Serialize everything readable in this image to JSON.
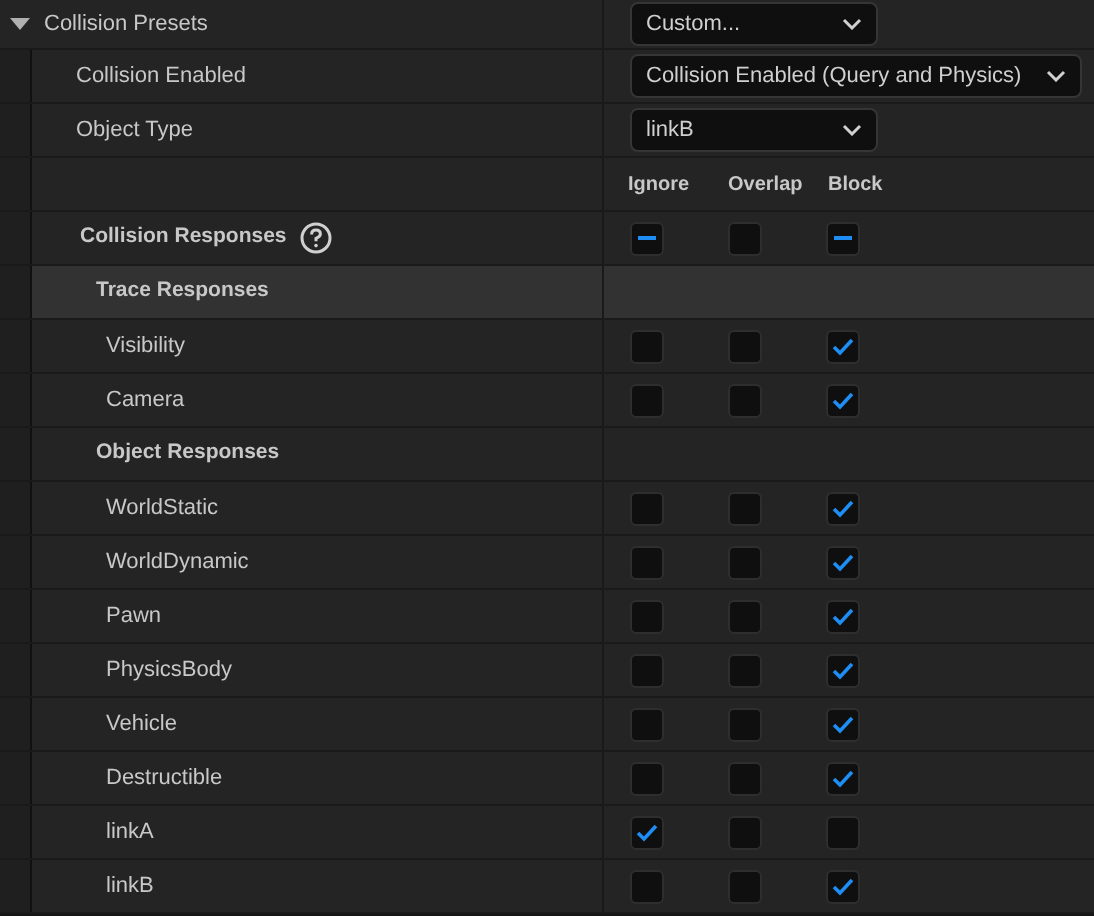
{
  "section": {
    "title": "Collision Presets",
    "expanded": true,
    "preset": "Custom..."
  },
  "properties": [
    {
      "label": "Collision Enabled",
      "value": "Collision Enabled (Query and Physics)"
    },
    {
      "label": "Object Type",
      "value": "linkB"
    }
  ],
  "columns": [
    "Ignore",
    "Overlap",
    "Block"
  ],
  "responses": {
    "label": "Collision Responses",
    "values": [
      {
        "indeterminate": true
      },
      {
        "indeterminate": false
      },
      {
        "indeterminate": true
      }
    ]
  },
  "groups": [
    {
      "title": "Trace Responses",
      "selected": true,
      "channels": [
        {
          "name": "Visibility",
          "values": [
            {
              "checked": false
            },
            {
              "checked": false
            },
            {
              "checked": true
            }
          ]
        },
        {
          "name": "Camera",
          "values": [
            {
              "checked": false
            },
            {
              "checked": false
            },
            {
              "checked": true
            }
          ]
        }
      ]
    },
    {
      "title": "Object Responses",
      "selected": false,
      "channels": [
        {
          "name": "WorldStatic",
          "values": [
            {
              "checked": false
            },
            {
              "checked": false
            },
            {
              "checked": true
            }
          ]
        },
        {
          "name": "WorldDynamic",
          "values": [
            {
              "checked": false
            },
            {
              "checked": false
            },
            {
              "checked": true
            }
          ]
        },
        {
          "name": "Pawn",
          "values": [
            {
              "checked": false
            },
            {
              "checked": false
            },
            {
              "checked": true
            }
          ]
        },
        {
          "name": "PhysicsBody",
          "values": [
            {
              "checked": false
            },
            {
              "checked": false
            },
            {
              "checked": true
            }
          ]
        },
        {
          "name": "Vehicle",
          "values": [
            {
              "checked": false
            },
            {
              "checked": false
            },
            {
              "checked": true
            }
          ]
        },
        {
          "name": "Destructible",
          "values": [
            {
              "checked": false
            },
            {
              "checked": false
            },
            {
              "checked": true
            }
          ]
        },
        {
          "name": "linkA",
          "values": [
            {
              "checked": true
            },
            {
              "checked": false
            },
            {
              "checked": false
            }
          ]
        },
        {
          "name": "linkB",
          "values": [
            {
              "checked": false
            },
            {
              "checked": false
            },
            {
              "checked": true
            }
          ]
        }
      ]
    }
  ]
}
